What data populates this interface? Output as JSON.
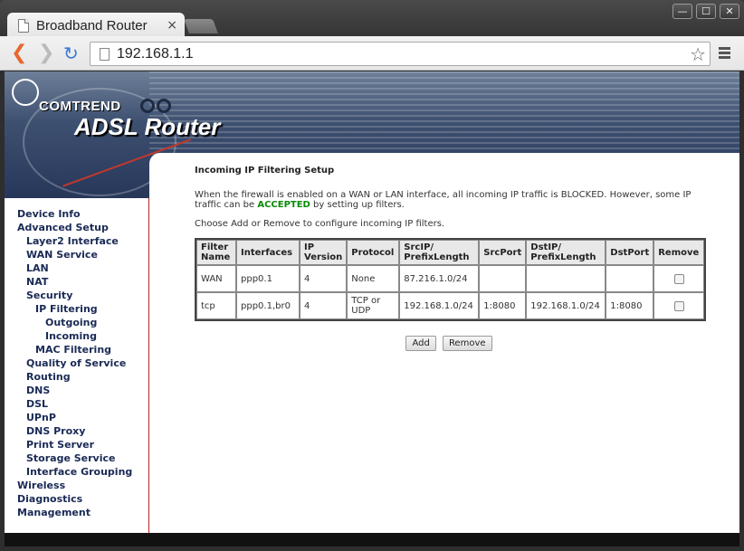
{
  "browser": {
    "tab_title": "Broadband Router",
    "tab_close": "×",
    "url": "192.168.1.1",
    "window_controls": [
      "—",
      "☐",
      "✕"
    ]
  },
  "header": {
    "brand": "COMTREND",
    "product": "ADSL Router"
  },
  "sidebar": {
    "items": [
      {
        "label": "Device Info",
        "level": 1
      },
      {
        "label": "Advanced Setup",
        "level": 1
      },
      {
        "label": "Layer2 Interface",
        "level": 2
      },
      {
        "label": "WAN Service",
        "level": 2
      },
      {
        "label": "LAN",
        "level": 2
      },
      {
        "label": "NAT",
        "level": 2
      },
      {
        "label": "Security",
        "level": 2
      },
      {
        "label": "IP Filtering",
        "level": 3
      },
      {
        "label": "Outgoing",
        "level": 4
      },
      {
        "label": "Incoming",
        "level": 4
      },
      {
        "label": "MAC Filtering",
        "level": 3
      },
      {
        "label": "Quality of Service",
        "level": 2
      },
      {
        "label": "Routing",
        "level": 2
      },
      {
        "label": "DNS",
        "level": 2
      },
      {
        "label": "DSL",
        "level": 2
      },
      {
        "label": "UPnP",
        "level": 2
      },
      {
        "label": "DNS Proxy",
        "level": 2
      },
      {
        "label": "Print Server",
        "level": 2
      },
      {
        "label": "Storage Service",
        "level": 2
      },
      {
        "label": "Interface Grouping",
        "level": 2
      },
      {
        "label": "Wireless",
        "level": 1
      },
      {
        "label": "Diagnostics",
        "level": 1
      },
      {
        "label": "Management",
        "level": 1
      }
    ]
  },
  "main": {
    "title": "Incoming IP Filtering Setup",
    "desc_part1": "When the firewall is enabled on a WAN or LAN interface, all incoming IP traffic is BLOCKED. However, some IP traffic can be ",
    "desc_accepted": "ACCEPTED",
    "desc_part2": " by setting up filters.",
    "instructions": "Choose Add or Remove to configure incoming IP filters.",
    "table": {
      "headers": [
        "Filter Name",
        "Interfaces",
        "IP Version",
        "Protocol",
        "SrcIP/ PrefixLength",
        "SrcPort",
        "DstIP/ PrefixLength",
        "DstPort",
        "Remove"
      ],
      "rows": [
        [
          "WAN",
          "ppp0.1",
          "4",
          "None",
          "87.216.1.0/24",
          "",
          "",
          ""
        ],
        [
          "tcp",
          "ppp0.1,br0",
          "4",
          "TCP or UDP",
          "192.168.1.0/24",
          "1:8080",
          "192.168.1.0/24",
          "1:8080"
        ]
      ]
    },
    "add_label": "Add",
    "remove_label": "Remove"
  },
  "colors": {
    "accepted": "#0a8a0a",
    "nav_text": "#1a2a55",
    "sidebar_border": "#b22"
  }
}
